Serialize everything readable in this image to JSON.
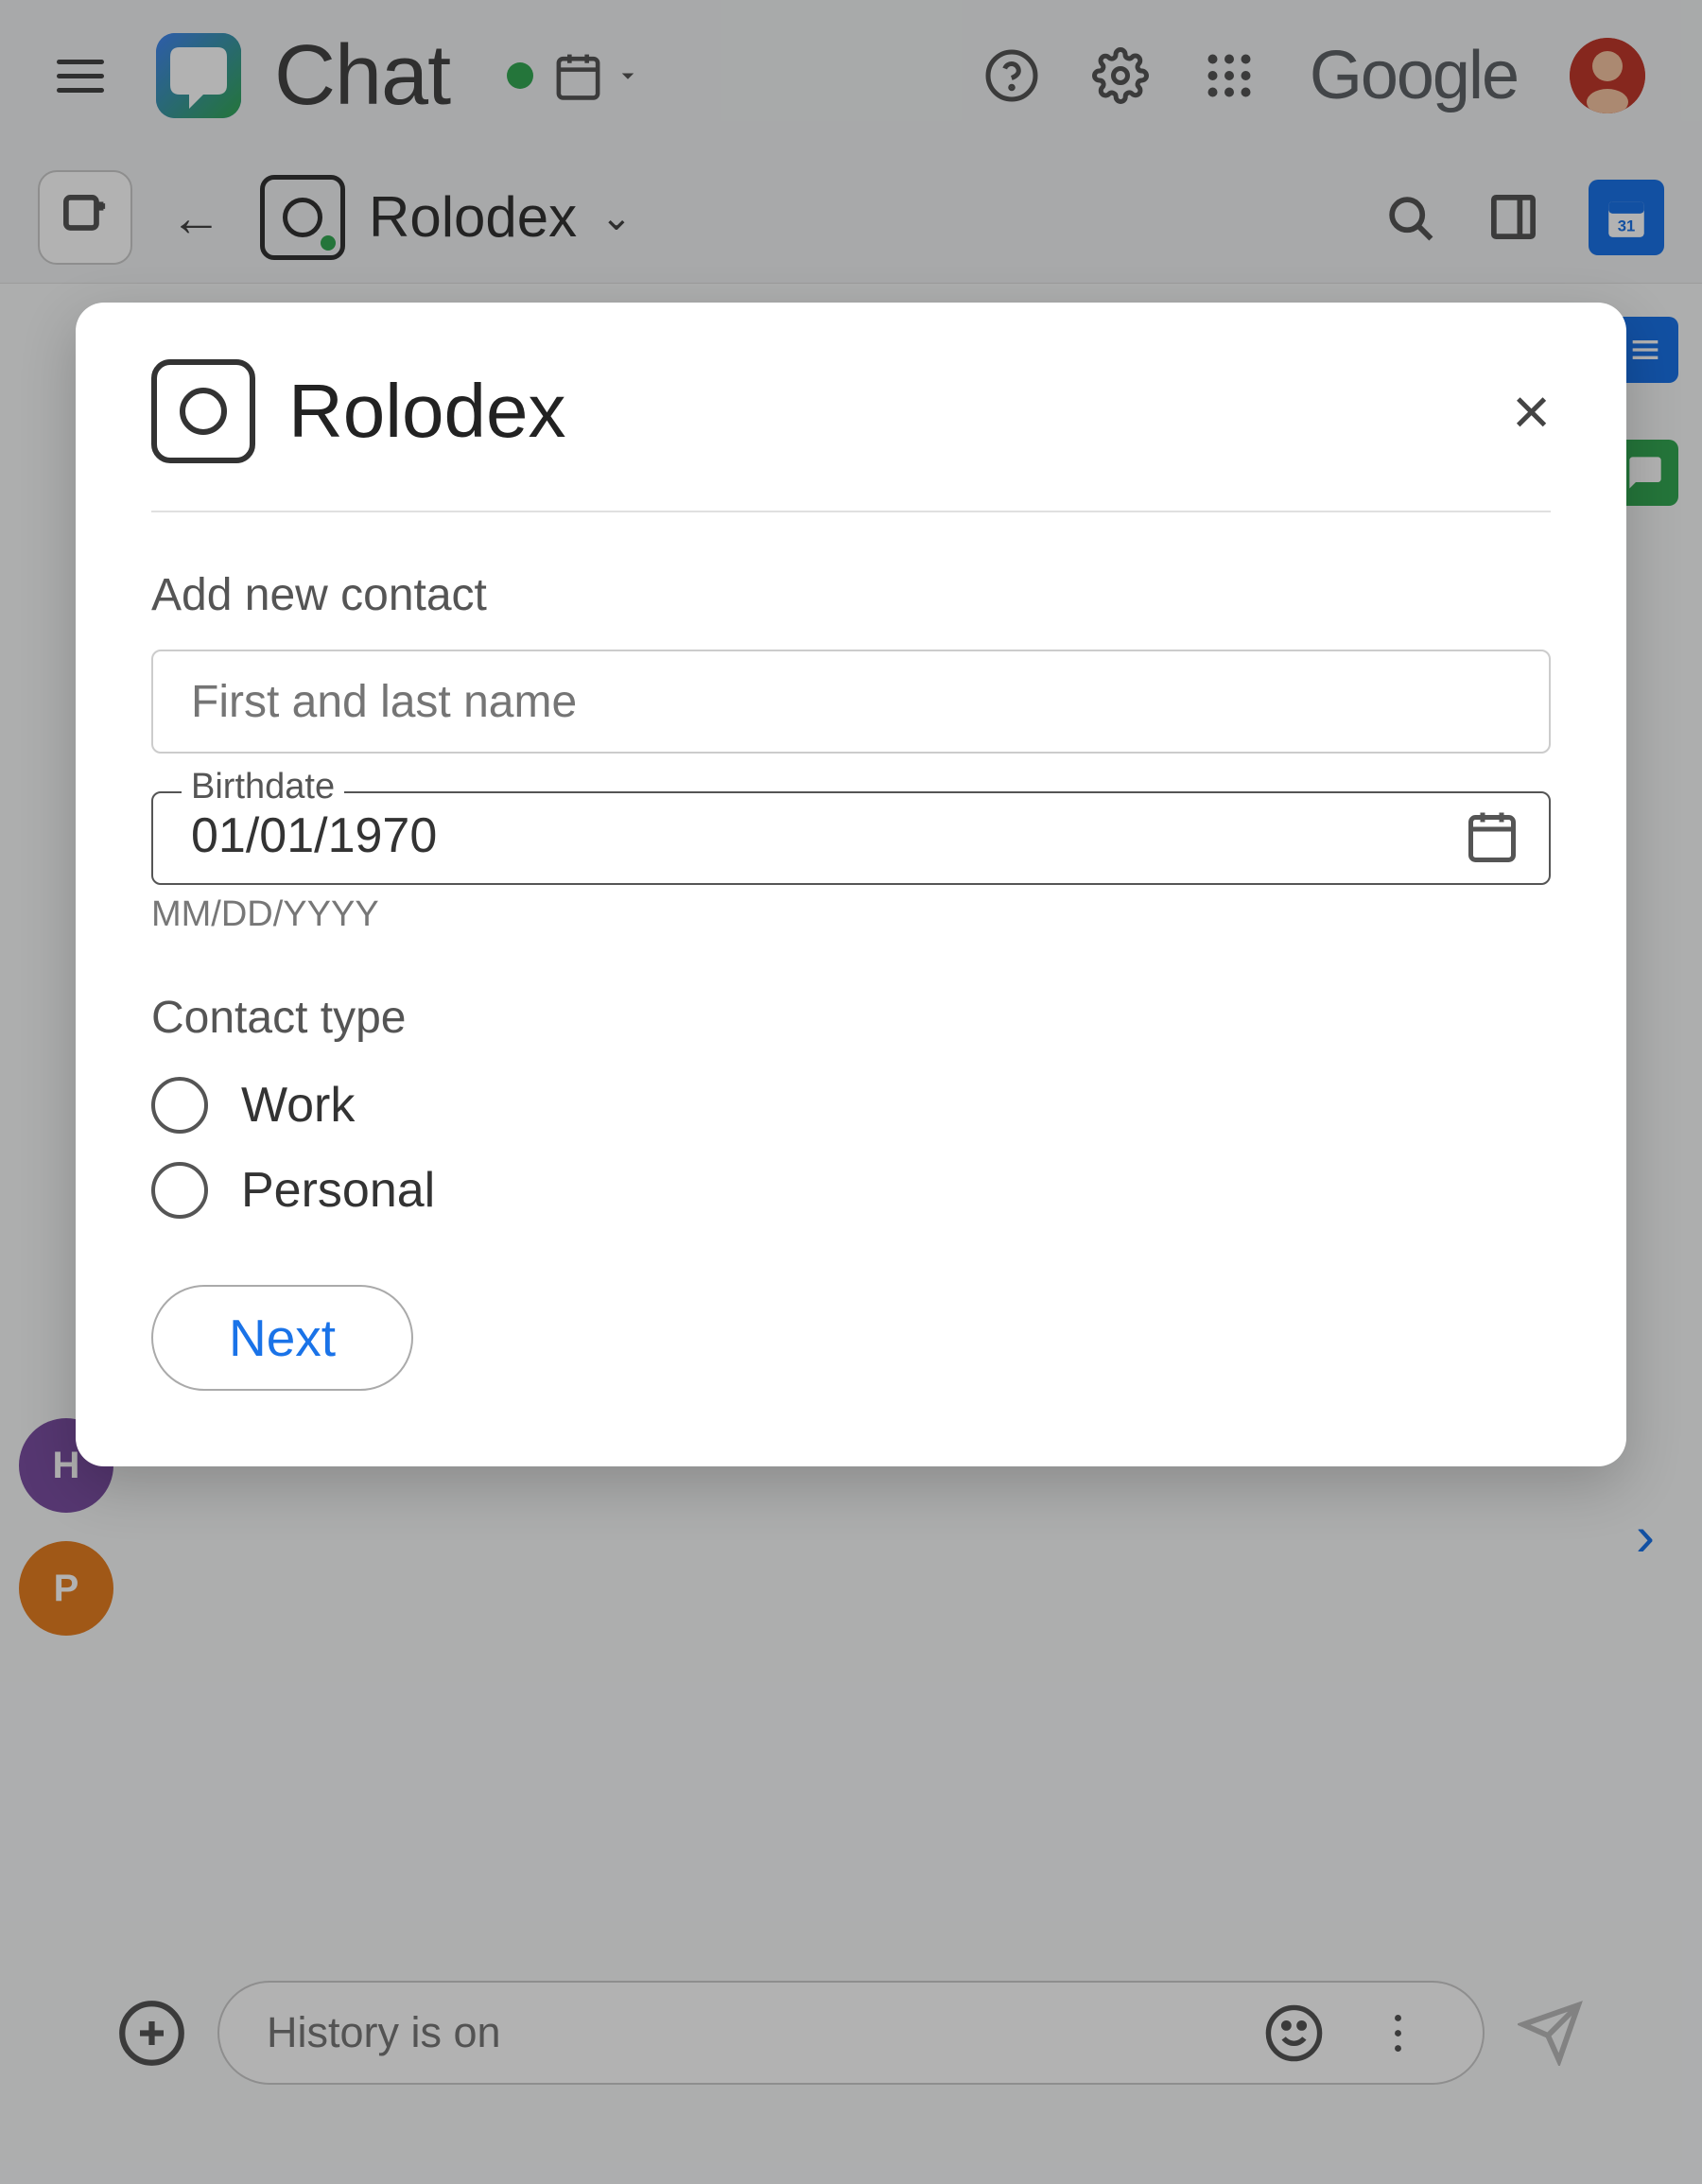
{
  "app": {
    "title": "Chat",
    "google_text": "Google"
  },
  "topnav": {
    "status_color": "#34a853",
    "rolodex_label": "Rolodex"
  },
  "modal": {
    "title": "Rolodex",
    "close_label": "×",
    "section_add": "Add new contact",
    "name_placeholder": "First and last name",
    "birthdate_label": "Birthdate",
    "birthdate_value": "01/01/1970",
    "birthdate_format": "MM/DD/YYYY",
    "contact_type_label": "Contact type",
    "radio_work": "Work",
    "radio_personal": "Personal",
    "next_btn": "Next"
  },
  "bottom_bar": {
    "history_text": "History is on"
  },
  "sidebar": {
    "icons": [
      {
        "letter": "H",
        "color": "#7b4fa3"
      },
      {
        "letter": "P",
        "color": "#e67e22"
      }
    ]
  }
}
